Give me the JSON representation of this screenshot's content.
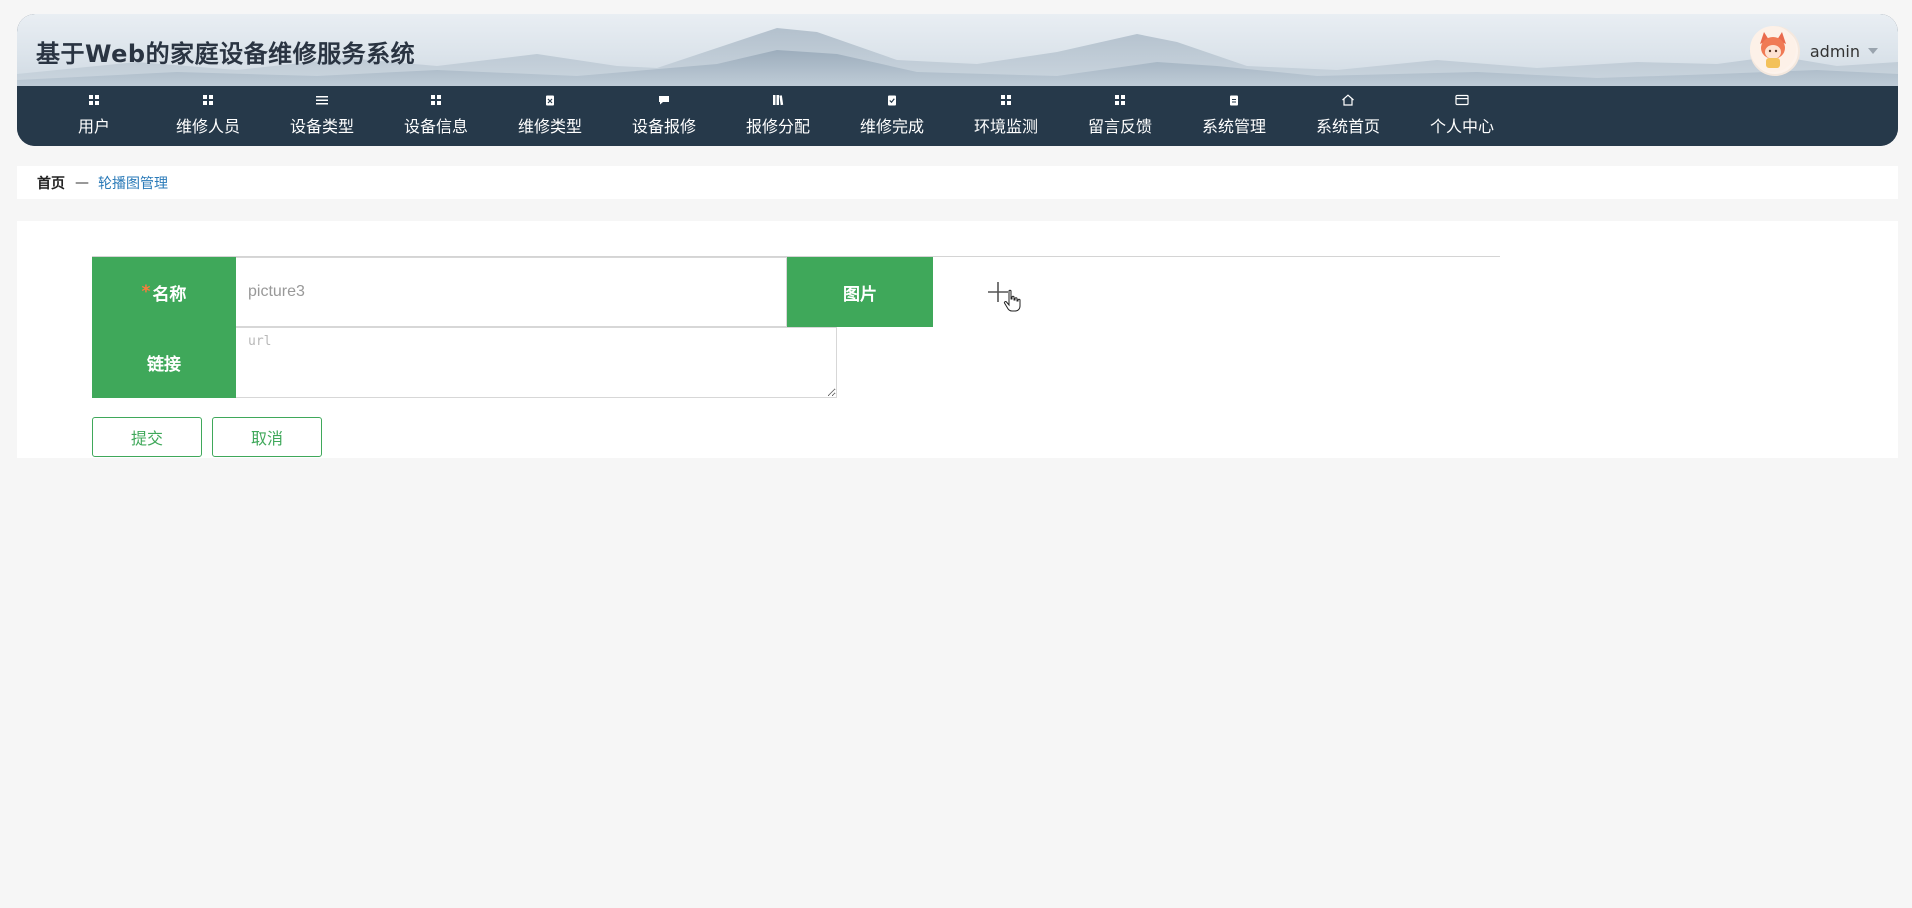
{
  "app": {
    "title": "基于Web的家庭设备维修服务系统"
  },
  "user": {
    "name": "admin",
    "avatar_icon": "avatar-fox-girl"
  },
  "nav": {
    "items": [
      {
        "label": "用户",
        "icon": "grid-icon"
      },
      {
        "label": "维修人员",
        "icon": "grid-icon"
      },
      {
        "label": "设备类型",
        "icon": "list-icon"
      },
      {
        "label": "设备信息",
        "icon": "grid-icon"
      },
      {
        "label": "维修类型",
        "icon": "clipboard-x-icon"
      },
      {
        "label": "设备报修",
        "icon": "chat-icon"
      },
      {
        "label": "报修分配",
        "icon": "books-icon"
      },
      {
        "label": "维修完成",
        "icon": "clipboard-check-icon"
      },
      {
        "label": "环境监测",
        "icon": "grid-icon"
      },
      {
        "label": "留言反馈",
        "icon": "grid-icon"
      },
      {
        "label": "系统管理",
        "icon": "clipboard-icon"
      },
      {
        "label": "系统首页",
        "icon": "home-icon"
      },
      {
        "label": "个人中心",
        "icon": "card-icon"
      }
    ]
  },
  "breadcrumb": {
    "home": "首页",
    "separator": "—",
    "current": "轮播图管理"
  },
  "form": {
    "name_label": "名称",
    "required_mark": "*",
    "name_value": "picture3",
    "image_label": "图片",
    "link_label": "链接",
    "link_placeholder": "url",
    "submit_label": "提交",
    "cancel_label": "取消"
  },
  "colors": {
    "nav_bg": "#26394a",
    "accent_green": "#3fa85a",
    "breadcrumb_link": "#2a7ab8",
    "required_star": "#ff7b3b"
  }
}
